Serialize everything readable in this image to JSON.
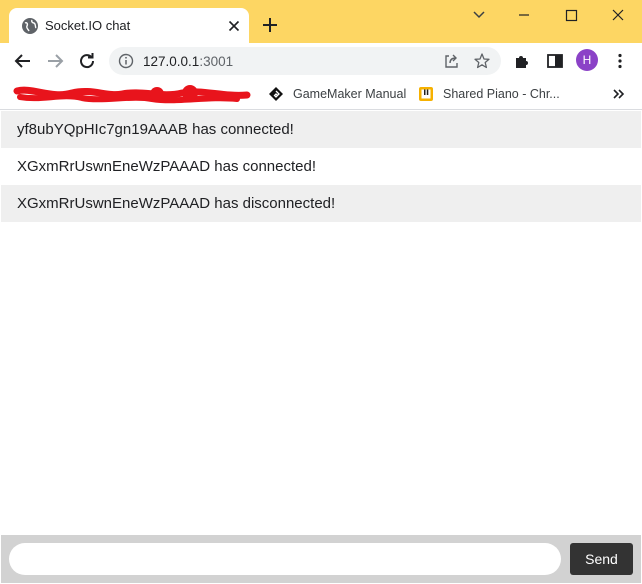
{
  "browser": {
    "tab": {
      "title": "Socket.IO chat"
    },
    "address": {
      "host": "127.0.0.1",
      "port": ":3001"
    },
    "profile_initial": "H",
    "bookmarks": [
      {
        "label": "GameMaker Manual",
        "icon": "gamemaker-icon"
      },
      {
        "label": "Shared Piano - Chr...",
        "icon": "shared-piano-icon"
      }
    ],
    "colors": {
      "titlebar": "#fdd663",
      "avatar": "#8b42c7",
      "redaction": "#e8141c"
    }
  },
  "chat": {
    "messages": [
      "yf8ubYQpHIc7gn19AAAB has connected!",
      "XGxmRrUswnEneWzPAAAD has connected!",
      "XGxmRrUswnEneWzPAAAD has disconnected!"
    ],
    "input_value": "",
    "send_label": "Send"
  }
}
